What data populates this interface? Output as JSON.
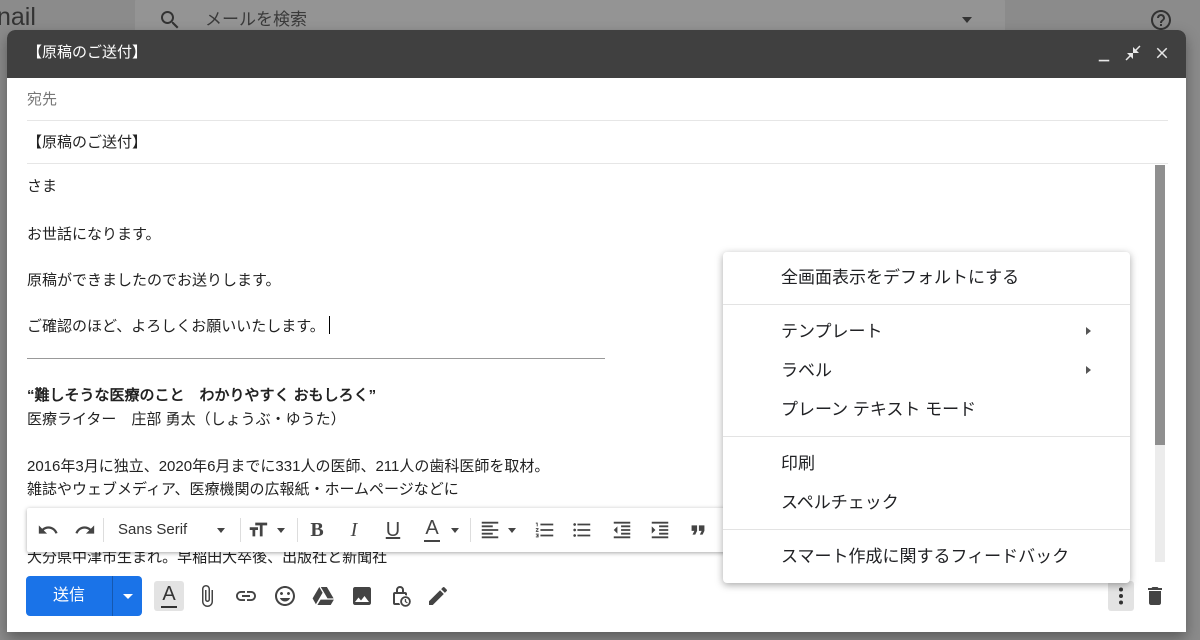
{
  "background": {
    "logo_text": "nail",
    "search_placeholder": "メールを検索",
    "icons": [
      "search-icon",
      "chevron-down-icon",
      "help-icon"
    ]
  },
  "compose": {
    "title": "【原稿のご送付】",
    "header_icons": [
      "minimize-icon",
      "exit-fullscreen-icon",
      "close-icon"
    ],
    "to_label": "宛先",
    "subject": "【原稿のご送付】",
    "body": {
      "lines": [
        "さま",
        "お世話になります。",
        "原稿ができましたのでお送りします。",
        "ご確認のほど、よろしくお願いいたします。"
      ],
      "signature": {
        "tagline": "“難しそうな医療のこと　わかりやすく おもしろく”",
        "name": "医療ライター　庄部 勇太（しょうぶ・ゆうた）",
        "bio": [
          "2016年3月に独立、2020年6月までに331人の医師、211人の歯科医師を取材。",
          "雑誌やウェブメディア、医療機関の広報紙・ホームページなどに",
          "大分県中津市生まれ。早稲田大卒後、出版社と新聞社"
        ]
      }
    }
  },
  "format_toolbar": {
    "font_family": "Sans Serif",
    "bold": "B",
    "italic": "I",
    "underline": "U",
    "text_color": "A",
    "icons": [
      "undo-icon",
      "redo-icon",
      "font-size-icon",
      "align-icon",
      "numbered-list-icon",
      "bulleted-list-icon",
      "indent-less-icon",
      "indent-more-icon",
      "quote-icon"
    ]
  },
  "bottom_bar": {
    "send_label": "送信",
    "format_toggle": "A",
    "icons": [
      "attach-icon",
      "link-icon",
      "emoji-icon",
      "drive-icon",
      "photo-icon",
      "confidential-mode-icon",
      "signature-icon",
      "more-options-icon",
      "trash-icon"
    ]
  },
  "more_menu": {
    "items": [
      {
        "label": "全画面表示をデフォルトにする",
        "submenu": false
      },
      {
        "label": "テンプレート",
        "submenu": true
      },
      {
        "label": "ラベル",
        "submenu": true
      },
      {
        "label": "プレーン テキスト モード",
        "submenu": false
      },
      {
        "label": "印刷",
        "submenu": false
      },
      {
        "label": "スペルチェック",
        "submenu": false
      },
      {
        "label": "スマート作成に関するフィードバック",
        "submenu": false
      }
    ]
  },
  "colors": {
    "accent": "#1a73e8",
    "header": "#404040",
    "overlay": "#8b8b8b"
  }
}
